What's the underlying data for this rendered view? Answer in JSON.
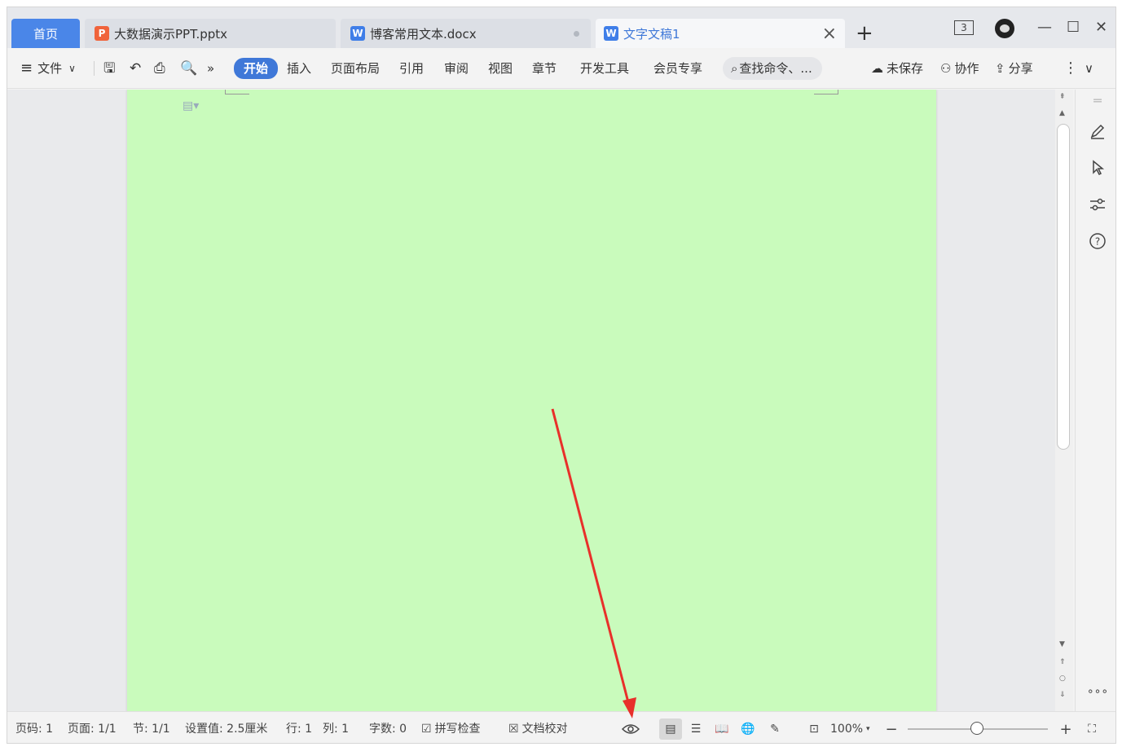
{
  "tabs": {
    "home": "首页",
    "ppt": "大数据演示PPT.pptx",
    "docx": "博客常用文本.docx",
    "active": "文字文稿1"
  },
  "window": {
    "badge": "3"
  },
  "ribbon": {
    "file": "文件",
    "start": "开始",
    "insert": "插入",
    "layout": "页面布局",
    "reference": "引用",
    "review": "审阅",
    "view": "视图",
    "chapter": "章节",
    "devtools": "开发工具",
    "member": "会员专享",
    "search_placeholder": "查找命令、...",
    "unsaved": "未保存",
    "collab": "协作",
    "share": "分享"
  },
  "status": {
    "page_num": "页码: 1",
    "page": "页面: 1/1",
    "section": "节: 1/1",
    "setting": "设置值: 2.5厘米",
    "row": "行: 1",
    "col": "列: 1",
    "wordcount": "字数: 0",
    "spellcheck": "拼写检查",
    "proofread": "文档校对",
    "zoom": "100%"
  },
  "colors": {
    "page_background": "#c9fbbc",
    "accent": "#3f78d8",
    "annotation_arrow": "#e8302a"
  }
}
